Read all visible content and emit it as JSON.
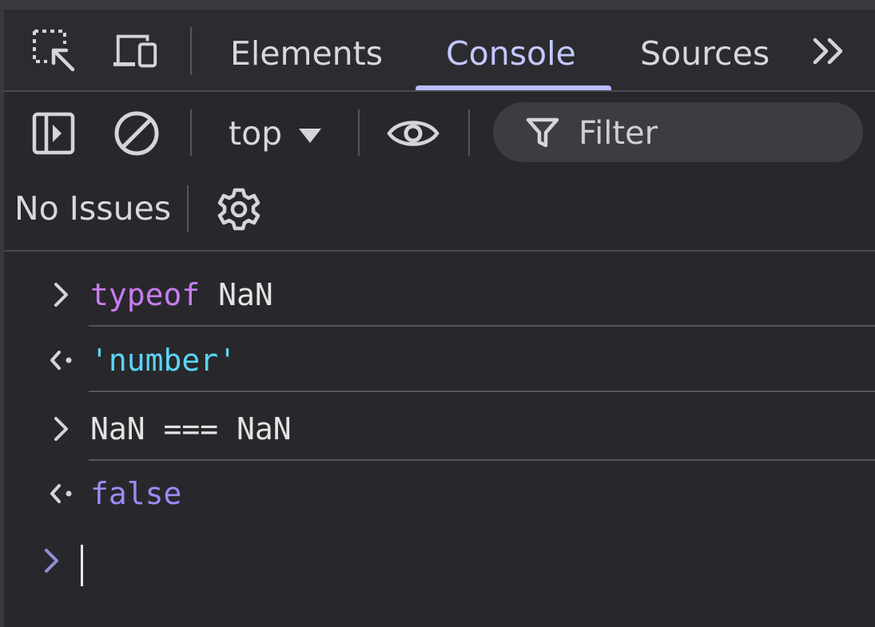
{
  "tabs": {
    "items": [
      {
        "label": "Elements",
        "active": false
      },
      {
        "label": "Console",
        "active": true
      },
      {
        "label": "Sources",
        "active": false
      }
    ],
    "more_icon": "double-chevron-right-icon",
    "inspect_icon": "inspect-element-icon",
    "device_icon": "device-toolbar-icon"
  },
  "toolbar": {
    "sidebar_icon": "show-sidebar-icon",
    "clear_icon": "clear-console-icon",
    "context": "top",
    "eye_icon": "live-expression-icon",
    "filter_placeholder": "Filter",
    "filter_value": "",
    "issues_label": "No Issues",
    "settings_icon": "gear-icon"
  },
  "console": {
    "entries": [
      {
        "kind": "input",
        "tokens": [
          {
            "text": "typeof",
            "type": "keyword"
          },
          {
            "text": " NaN",
            "type": "plain"
          }
        ]
      },
      {
        "kind": "output",
        "tokens": [
          {
            "text": "'number'",
            "type": "string"
          }
        ]
      },
      {
        "kind": "input",
        "tokens": [
          {
            "text": "NaN === NaN",
            "type": "plain"
          }
        ]
      },
      {
        "kind": "output",
        "tokens": [
          {
            "text": "false",
            "type": "boolean"
          }
        ]
      }
    ],
    "prompt_value": ""
  },
  "colors": {
    "background": "#28282c",
    "tab_bar": "#2b2b30",
    "active_tab": "#c3c8ff",
    "keyword": "#c97cf0",
    "string": "#5dd4f7",
    "boolean": "#9f8af7",
    "prompt": "#8f8fd6"
  }
}
